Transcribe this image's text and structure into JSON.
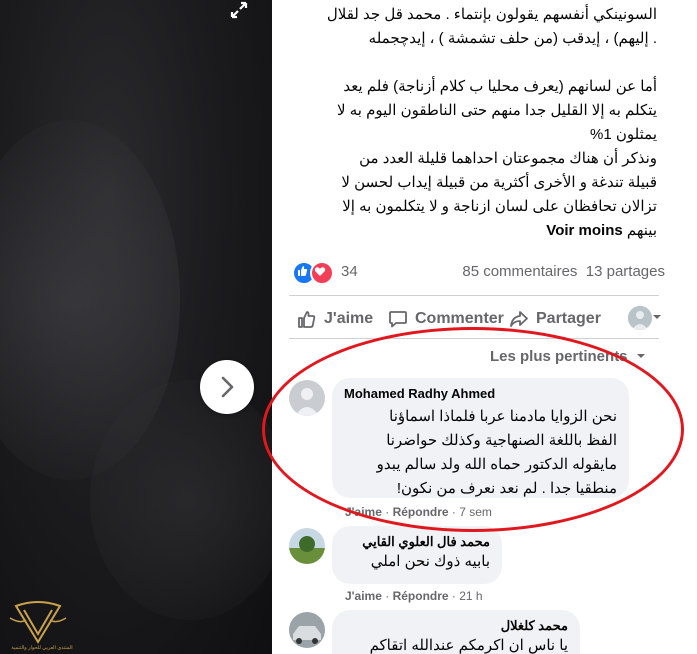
{
  "photo": {
    "expand_icon": "expand-icon",
    "next_icon": "chevron-right-icon",
    "logo_caption": "المنتدى العربي للحوار والتنمية"
  },
  "post": {
    "lines": [
      "السونينكي أنفسهم يقولون بإنتماء . محمد قل جد لقلال",
      ". إليهم) ، إيدقب (من حلف تشمشة ) ، إيدچجمله",
      "",
      "أما عن لسانهم (يعرف محليا ب كلام أزناجة) فلم يعد",
      "يتكلم به إلا القليل جدا منهم حتى الناطقون اليوم به لا",
      "يمثلون 1%",
      "ونذكر أن هناك مجموعتان احداهما قليلة العدد من",
      "قبيلة تندغة و الأخرى أكثرية من قبيلة إيداب لحسن لا",
      "تزالان تحافظان على لسان ازناجة و لا يتكلمون به إلا"
    ],
    "last_line": "بينهم",
    "see_less": "Voir moins"
  },
  "reactions": {
    "count": "34",
    "comments": "85 commentaires",
    "shares": "13 partages",
    "like_color": "#1877f2",
    "love_color": "#f33e58"
  },
  "actions": {
    "like": "J'aime",
    "comment": "Commenter",
    "share": "Partager"
  },
  "sort_label": "Les plus pertinents",
  "comments": [
    {
      "author": "Mohamed Radhy Ahmed",
      "lines": [
        "نحن الزوايا مادمنا عربا فلماذا اسماؤنا",
        "الفظ باللغة الصنهاجية وكذلك حواضرنا",
        "مايقوله الدكتور حماه الله ولد سالم يبدو",
        "منطقيا جدا . لم نعد نعرف من نكون!"
      ],
      "like": "J'aime",
      "reply": "Répondre",
      "time": "7 sem"
    },
    {
      "author": "محمد فال العلوي القايي",
      "lines": [
        "بابيه ذوك نحن املي"
      ],
      "like": "J'aime",
      "reply": "Répondre",
      "time": "21 h"
    },
    {
      "author": "محمد كلغلال",
      "lines": [
        "يا ناس ان اكرمكم عندالله اتقاكم"
      ]
    }
  ],
  "highlight_color": "#e1171e"
}
